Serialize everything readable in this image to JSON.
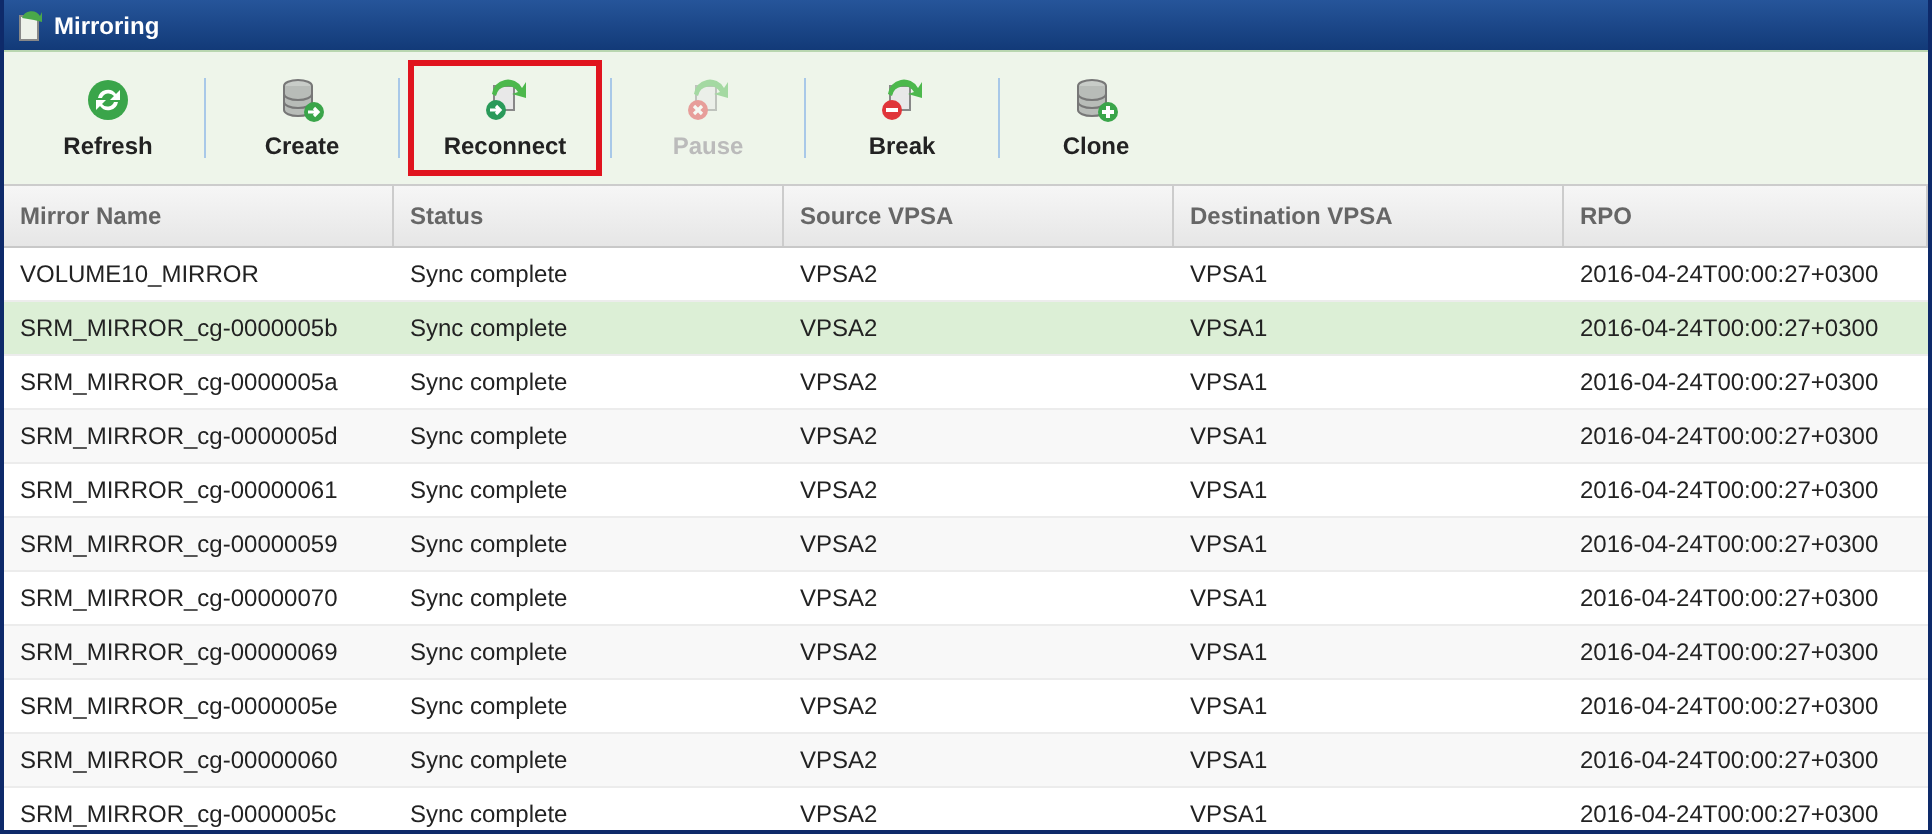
{
  "window": {
    "title": "Mirroring"
  },
  "toolbar": [
    {
      "label": "Refresh",
      "kind": "refresh",
      "disabled": false,
      "highlighted": false
    },
    {
      "label": "Create",
      "kind": "create",
      "disabled": false,
      "highlighted": false
    },
    {
      "label": "Reconnect",
      "kind": "reconnect",
      "disabled": false,
      "highlighted": true
    },
    {
      "label": "Pause",
      "kind": "pause",
      "disabled": true,
      "highlighted": false
    },
    {
      "label": "Break",
      "kind": "break",
      "disabled": false,
      "highlighted": false
    },
    {
      "label": "Clone",
      "kind": "clone",
      "disabled": false,
      "highlighted": false
    }
  ],
  "table": {
    "columns": [
      "Mirror Name",
      "Status",
      "Source VPSA",
      "Destination VPSA",
      "RPO"
    ],
    "rows": [
      {
        "cells": [
          "VOLUME10_MIRROR",
          "Sync complete",
          "VPSA2",
          "VPSA1",
          "2016-04-24T00:00:27+0300"
        ],
        "selected": false
      },
      {
        "cells": [
          "SRM_MIRROR_cg-0000005b",
          "Sync complete",
          "VPSA2",
          "VPSA1",
          "2016-04-24T00:00:27+0300"
        ],
        "selected": true
      },
      {
        "cells": [
          "SRM_MIRROR_cg-0000005a",
          "Sync complete",
          "VPSA2",
          "VPSA1",
          "2016-04-24T00:00:27+0300"
        ],
        "selected": false
      },
      {
        "cells": [
          "SRM_MIRROR_cg-0000005d",
          "Sync complete",
          "VPSA2",
          "VPSA1",
          "2016-04-24T00:00:27+0300"
        ],
        "selected": false
      },
      {
        "cells": [
          "SRM_MIRROR_cg-00000061",
          "Sync complete",
          "VPSA2",
          "VPSA1",
          "2016-04-24T00:00:27+0300"
        ],
        "selected": false
      },
      {
        "cells": [
          "SRM_MIRROR_cg-00000059",
          "Sync complete",
          "VPSA2",
          "VPSA1",
          "2016-04-24T00:00:27+0300"
        ],
        "selected": false
      },
      {
        "cells": [
          "SRM_MIRROR_cg-00000070",
          "Sync complete",
          "VPSA2",
          "VPSA1",
          "2016-04-24T00:00:27+0300"
        ],
        "selected": false
      },
      {
        "cells": [
          "SRM_MIRROR_cg-00000069",
          "Sync complete",
          "VPSA2",
          "VPSA1",
          "2016-04-24T00:00:27+0300"
        ],
        "selected": false
      },
      {
        "cells": [
          "SRM_MIRROR_cg-0000005e",
          "Sync complete",
          "VPSA2",
          "VPSA1",
          "2016-04-24T00:00:27+0300"
        ],
        "selected": false
      },
      {
        "cells": [
          "SRM_MIRROR_cg-00000060",
          "Sync complete",
          "VPSA2",
          "VPSA1",
          "2016-04-24T00:00:27+0300"
        ],
        "selected": false
      },
      {
        "cells": [
          "SRM_MIRROR_cg-0000005c",
          "Sync complete",
          "VPSA2",
          "VPSA1",
          "2016-04-24T00:00:27+0300"
        ],
        "selected": false
      }
    ]
  }
}
